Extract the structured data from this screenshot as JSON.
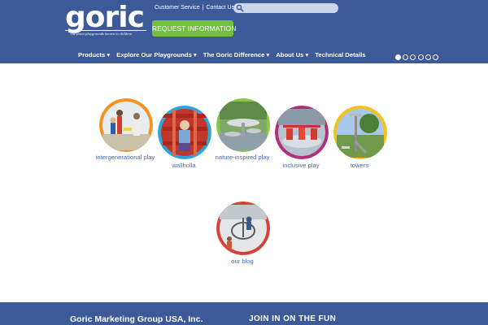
{
  "header": {
    "logo": {
      "word": "goric",
      "tagline": "The finest playgrounds known to children"
    },
    "top_links": {
      "customer_service": "Customer Service",
      "separator": "|",
      "contact": "Contact Us"
    },
    "search": {
      "placeholder": ""
    },
    "cta": "REQUEST INFORMATION",
    "nav": [
      {
        "label": "Products",
        "caret": "▾"
      },
      {
        "label": "Explore Our Playgrounds",
        "caret": "▾"
      },
      {
        "label": "The Goric Difference",
        "caret": "▾"
      },
      {
        "label": "About Us",
        "caret": "▾"
      },
      {
        "label": "Technical Details"
      }
    ],
    "slider_dots": {
      "count": 6,
      "active_index": 0
    }
  },
  "tiles": [
    {
      "label": "intergenerational play",
      "ring_color": "#f6921e",
      "image": "photo-adults-children-playground"
    },
    {
      "label": "wallholla",
      "ring_color": "#2aa6d8",
      "image": "photo-child-climbing-wallholla"
    },
    {
      "label": "nature-inspired play",
      "ring_color": "#8cc63f",
      "image": "photo-nature-play-structure"
    },
    {
      "label": "inclusive play",
      "ring_color": "#b0307a",
      "image": "photo-inclusive-merry-go-round"
    },
    {
      "label": "towers",
      "ring_color": "#f4c21a",
      "image": "photo-play-towers"
    },
    {
      "label": "our blog",
      "ring_color": "#d8413a",
      "image": "photo-children-spinner-snow"
    }
  ],
  "footer": {
    "company": "Goric Marketing Group USA, Inc.",
    "join": "JOIN IN ON THE FUN"
  },
  "colors": {
    "brand_blue": "#3d5a98",
    "cta_green": "#72bf44",
    "label_blue": "#4a6aa8"
  }
}
